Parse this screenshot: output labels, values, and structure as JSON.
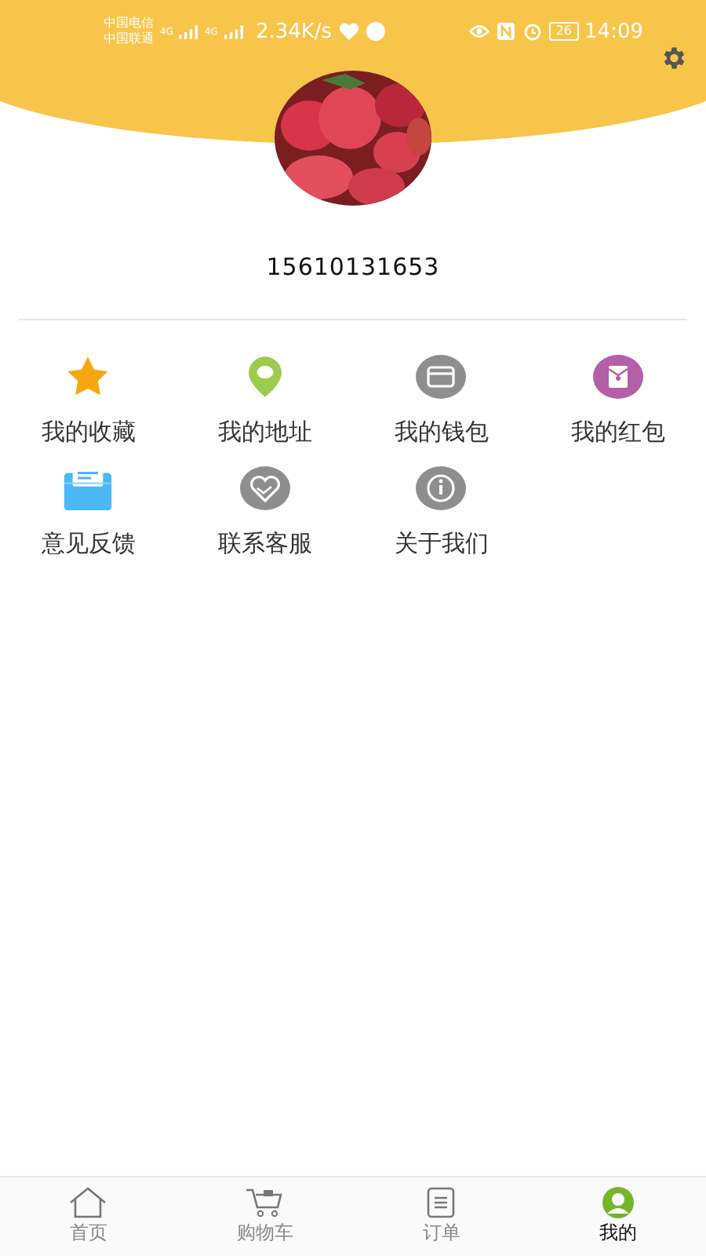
{
  "status_bar": {
    "carriers": [
      "中国电信",
      "中国联通"
    ],
    "network_tags": [
      "4G",
      "4G"
    ],
    "speed": "2.34K/s",
    "battery": "26",
    "time": "14:09"
  },
  "profile": {
    "phone": "15610131653"
  },
  "menu": [
    {
      "label": "我的收藏",
      "kind": "star"
    },
    {
      "label": "我的地址",
      "kind": "pin"
    },
    {
      "label": "我的钱包",
      "kind": "wallet"
    },
    {
      "label": "我的红包",
      "kind": "envelope"
    },
    {
      "label": "意见反馈",
      "kind": "feedback"
    },
    {
      "label": "联系客服",
      "kind": "service"
    },
    {
      "label": "关于我们",
      "kind": "about"
    }
  ],
  "tabs": [
    {
      "label": "首页",
      "kind": "home",
      "selected": false
    },
    {
      "label": "购物车",
      "kind": "cart",
      "selected": false
    },
    {
      "label": "订单",
      "kind": "order",
      "selected": false
    },
    {
      "label": "我的",
      "kind": "me",
      "selected": true
    }
  ]
}
